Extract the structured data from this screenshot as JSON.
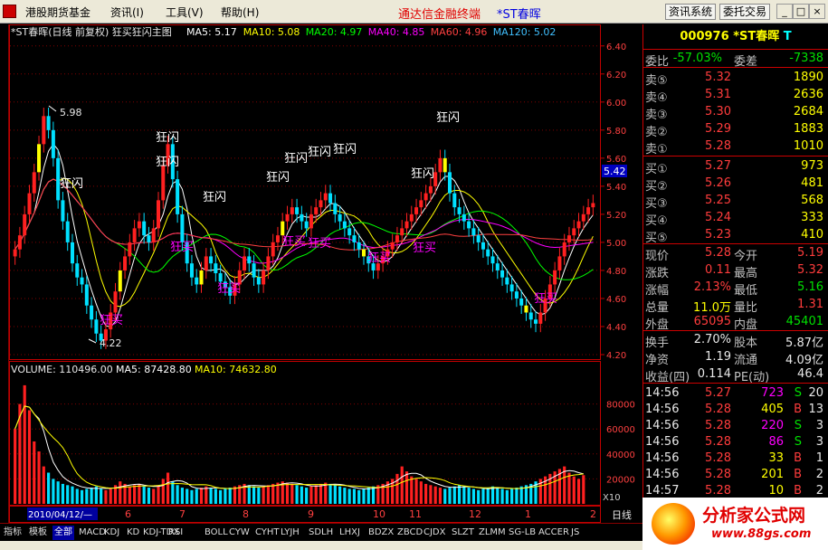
{
  "menubar": {
    "items": [
      "港股期货基金",
      "资讯(I)",
      "工具(V)",
      "帮助(H)"
    ],
    "title": "通达信金融终端",
    "stock": "*ST春晖",
    "btn_info": "资讯系统",
    "btn_trade": "委托交易",
    "win_buttons": [
      "_",
      "□",
      "×"
    ]
  },
  "main_chart": {
    "title": "*ST春晖(日线 前复权) 狂买狂闪主图",
    "ma_labels": [
      {
        "text": "MA5: 5.17",
        "color": "#ffffff"
      },
      {
        "text": "MA10: 5.08",
        "color": "#ffff00"
      },
      {
        "text": "MA20: 4.97",
        "color": "#00ff00"
      },
      {
        "text": "MA40: 4.85",
        "color": "#ff00ff"
      },
      {
        "text": "MA60: 4.96",
        "color": "#ff4040"
      },
      {
        "text": "MA120: 5.02",
        "color": "#40c0ff"
      }
    ],
    "y_ticks": [
      "6.40",
      "6.20",
      "6.00",
      "5.80",
      "5.60",
      "5.40",
      "5.20",
      "5.00",
      "4.80",
      "4.60",
      "4.40",
      "4.20"
    ],
    "price_tag": "5.42",
    "high_label": "5.98",
    "low_label": "4.22",
    "sig_flash": "狂闪",
    "sig_buy": "狂买"
  },
  "volume": {
    "title": "VOLUME: 110496.00",
    "ma5": "MA5: 87428.80",
    "ma10": "MA10: 74632.80",
    "y_ticks": [
      "80000",
      "60000",
      "40000",
      "20000"
    ],
    "unit": "X10"
  },
  "x_axis": {
    "year": "2010/04/12/—",
    "months": [
      "6",
      "7",
      "8",
      "9",
      "10",
      "11",
      "12",
      "1",
      "2"
    ],
    "period": "日线"
  },
  "tabs": [
    "指标",
    "模板",
    "全部",
    "MACD",
    "KDJ",
    "KD",
    "KDJ-TDX",
    "RSI",
    "BOLL",
    "CYW",
    "CYHT",
    "LYJH",
    "SDLH",
    "LHXJ",
    "BDZX",
    "ZBCD",
    "CJDX",
    "SLZT",
    "ZLMM",
    "SG-LB",
    "ACCER",
    "JS"
  ],
  "panel": {
    "code": "000976",
    "name": "*ST春晖",
    "flag": "T",
    "weibi_label": "委比",
    "weibi": "-57.03%",
    "weicha_label": "委差",
    "weicha": "-7338",
    "sells": [
      {
        "label": "卖⑤",
        "price": "5.32",
        "vol": "1890"
      },
      {
        "label": "卖④",
        "price": "5.31",
        "vol": "2636"
      },
      {
        "label": "卖③",
        "price": "5.30",
        "vol": "2684"
      },
      {
        "label": "卖②",
        "price": "5.29",
        "vol": "1883"
      },
      {
        "label": "卖①",
        "price": "5.28",
        "vol": "1010"
      }
    ],
    "buys": [
      {
        "label": "买①",
        "price": "5.27",
        "vol": "973"
      },
      {
        "label": "买②",
        "price": "5.26",
        "vol": "481"
      },
      {
        "label": "买③",
        "price": "5.25",
        "vol": "568"
      },
      {
        "label": "买④",
        "price": "5.24",
        "vol": "333"
      },
      {
        "label": "买⑤",
        "price": "5.23",
        "vol": "410"
      }
    ],
    "stats": [
      {
        "l1": "现价",
        "v1": "5.28",
        "c1": "red",
        "l2": "今开",
        "v2": "5.19",
        "c2": "red"
      },
      {
        "l1": "涨跌",
        "v1": "0.11",
        "c1": "red",
        "l2": "最高",
        "v2": "5.32",
        "c2": "red"
      },
      {
        "l1": "涨幅",
        "v1": "2.13%",
        "c1": "red",
        "l2": "最低",
        "v2": "5.16",
        "c2": "grn"
      },
      {
        "l1": "总量",
        "v1": "11.0万",
        "c1": "yel",
        "l2": "量比",
        "v2": "1.31",
        "c2": "red"
      },
      {
        "l1": "外盘",
        "v1": "65095",
        "c1": "red",
        "l2": "内盘",
        "v2": "45401",
        "c2": "grn"
      }
    ],
    "fin": [
      {
        "l1": "换手",
        "v1": "2.70%",
        "l2": "股本",
        "v2": "5.87亿"
      },
      {
        "l1": "净资",
        "v1": "1.19",
        "l2": "流通",
        "v2": "4.09亿"
      },
      {
        "l1": "收益(四)",
        "v1": "0.114",
        "l2": "PE(动)",
        "v2": "46.4"
      }
    ],
    "ticks": [
      {
        "t": "14:56",
        "p": "5.27",
        "v": "723",
        "s": "S",
        "n": "20"
      },
      {
        "t": "14:56",
        "p": "5.28",
        "v": "405",
        "s": "B",
        "n": "13"
      },
      {
        "t": "14:56",
        "p": "5.28",
        "v": "220",
        "s": "S",
        "n": "3"
      },
      {
        "t": "14:56",
        "p": "5.28",
        "v": "86",
        "s": "S",
        "n": "3"
      },
      {
        "t": "14:56",
        "p": "5.28",
        "v": "33",
        "s": "B",
        "n": "1"
      },
      {
        "t": "14:56",
        "p": "5.28",
        "v": "201",
        "s": "B",
        "n": "2"
      },
      {
        "t": "14:57",
        "p": "5.28",
        "v": "10",
        "s": "B",
        "n": "2"
      }
    ]
  },
  "logo": {
    "main": "分析家公式网",
    "url": "www.88gs.com"
  },
  "colors": {
    "up": "#ff2020",
    "down": "#00e0ff",
    "flash": "#ffff00",
    "grid": "#800000",
    "axis": "#c00000"
  },
  "chart_data": {
    "type": "candlestick",
    "title": "*ST春晖(日线 前复权) 狂买狂闪主图",
    "ylim": [
      4.2,
      6.45
    ],
    "volume_ylim": [
      0,
      100000
    ],
    "high": 5.98,
    "low": 4.22,
    "close": [
      4.95,
      5.05,
      5.2,
      5.35,
      5.5,
      5.7,
      5.9,
      5.8,
      5.6,
      5.3,
      5.15,
      5.0,
      4.85,
      4.75,
      4.7,
      4.55,
      4.45,
      4.35,
      4.3,
      4.38,
      4.5,
      4.65,
      4.8,
      4.9,
      5.0,
      5.1,
      5.15,
      5.05,
      5.0,
      5.1,
      5.3,
      5.55,
      5.7,
      5.45,
      5.2,
      5.0,
      4.85,
      4.75,
      4.7,
      4.8,
      4.9,
      4.85,
      4.78,
      4.72,
      4.68,
      4.62,
      4.7,
      4.8,
      4.9,
      4.85,
      4.75,
      4.7,
      4.8,
      4.9,
      5.0,
      5.05,
      5.15,
      5.2,
      5.25,
      5.2,
      5.15,
      5.1,
      5.2,
      5.25,
      5.3,
      5.35,
      5.28,
      5.2,
      5.15,
      5.1,
      5.05,
      5.0,
      4.95,
      4.9,
      4.85,
      4.8,
      4.85,
      4.9,
      4.95,
      5.0,
      5.05,
      5.1,
      5.15,
      5.2,
      5.25,
      5.3,
      5.35,
      5.4,
      5.5,
      5.6,
      5.5,
      5.35,
      5.25,
      5.2,
      5.15,
      5.1,
      5.05,
      5.0,
      4.95,
      4.9,
      4.85,
      4.8,
      4.75,
      4.7,
      4.65,
      4.6,
      4.55,
      4.5,
      4.45,
      4.42,
      4.5,
      4.6,
      4.7,
      4.8,
      4.9,
      5.0,
      5.05,
      5.1,
      5.15,
      5.2,
      5.25,
      5.28
    ],
    "volume": [
      60000,
      80000,
      95000,
      75000,
      50000,
      42000,
      30000,
      25000,
      20000,
      18000,
      16000,
      15000,
      14000,
      12000,
      11000,
      12000,
      13000,
      14000,
      12000,
      11000,
      12000,
      15000,
      18000,
      16000,
      14000,
      15000,
      16000,
      14000,
      13000,
      12000,
      15000,
      20000,
      25000,
      18000,
      15000,
      13000,
      12000,
      11000,
      12000,
      13000,
      14000,
      13000,
      12000,
      11000,
      12000,
      13000,
      14000,
      15000,
      16000,
      15000,
      14000,
      13000,
      14000,
      15000,
      16000,
      17000,
      18000,
      17000,
      16000,
      15000,
      14000,
      13000,
      14000,
      15000,
      16000,
      17000,
      16000,
      15000,
      14000,
      13000,
      12000,
      12000,
      11000,
      12000,
      13000,
      14000,
      15000,
      16000,
      18000,
      20000,
      24000,
      30000,
      26000,
      22000,
      20000,
      18000,
      16000,
      15000,
      14000,
      13000,
      12000,
      13000,
      14000,
      15000,
      14000,
      13000,
      12000,
      11000,
      12000,
      13000,
      14000,
      13000,
      12000,
      11000,
      12000,
      13000,
      14000,
      15000,
      16000,
      18000,
      20000,
      22000,
      24000,
      26000,
      28000,
      30000,
      25000,
      22000,
      20000,
      23000
    ]
  }
}
